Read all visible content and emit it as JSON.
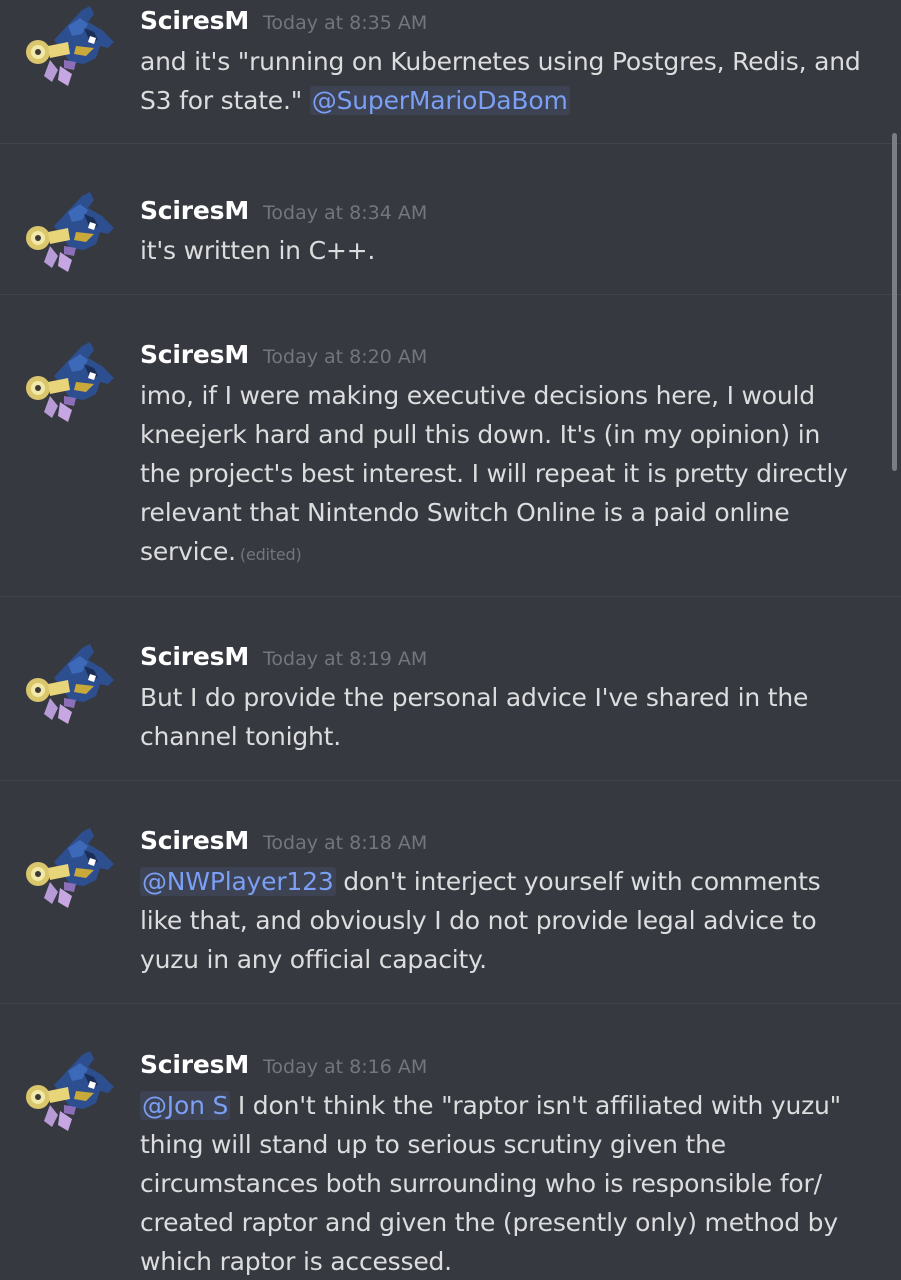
{
  "messages": [
    {
      "author": "SciresM",
      "time": "Today at 8:35 AM",
      "avatar_icon": "shark-character-avatar",
      "lines": [
        [
          {
            "t": "and it's \"running on Kubernetes using Postgres, Redis, and"
          }
        ],
        [
          {
            "t": "S3 for state.\" "
          },
          {
            "t": "@SuperMarioDaBom",
            "mention": true
          }
        ]
      ]
    },
    {
      "author": "SciresM",
      "time": "Today at 8:34 AM",
      "avatar_icon": "shark-character-avatar",
      "lines": [
        [
          {
            "t": "it's written in C++."
          }
        ]
      ]
    },
    {
      "author": "SciresM",
      "time": "Today at 8:20 AM",
      "avatar_icon": "shark-character-avatar",
      "lines": [
        [
          {
            "t": "imo, if I were making executive decisions here, I would"
          }
        ],
        [
          {
            "t": "kneejerk hard and pull this down. It's (in my opinion) in"
          }
        ],
        [
          {
            "t": "the project's best interest. I will repeat it is pretty directly"
          }
        ],
        [
          {
            "t": "relevant that Nintendo Switch Online is a paid online"
          }
        ],
        [
          {
            "t": "service."
          },
          {
            "t": "(edited)",
            "edited": true
          }
        ]
      ]
    },
    {
      "author": "SciresM",
      "time": "Today at 8:19 AM",
      "avatar_icon": "shark-character-avatar",
      "lines": [
        [
          {
            "t": "But I do provide the personal advice I've shared in the"
          }
        ],
        [
          {
            "t": "channel tonight."
          }
        ]
      ]
    },
    {
      "author": "SciresM",
      "time": "Today at 8:18 AM",
      "avatar_icon": "shark-character-avatar",
      "lines": [
        [
          {
            "t": "@NWPlayer123",
            "mention": true
          },
          {
            "t": " don't interject yourself with comments"
          }
        ],
        [
          {
            "t": "like that, and obviously I do not provide legal advice to"
          }
        ],
        [
          {
            "t": "yuzu in any official capacity."
          }
        ]
      ]
    },
    {
      "author": "SciresM",
      "time": "Today at 8:16 AM",
      "avatar_icon": "shark-character-avatar",
      "lines": [
        [
          {
            "t": "@Jon S",
            "mention": true
          },
          {
            "t": " I don't think the \"raptor isn't affiliated with yuzu\""
          }
        ],
        [
          {
            "t": "thing will stand up to serious scrutiny given the"
          }
        ],
        [
          {
            "t": "circumstances both surrounding who is responsible for/"
          }
        ],
        [
          {
            "t": "created raptor and given the (presently only) method by"
          }
        ],
        [
          {
            "t": "which raptor is accessed."
          }
        ]
      ]
    }
  ],
  "colors": {
    "background": "#36393f",
    "divider": "#42454b",
    "author": "#ffffff",
    "timestamp": "#72767d",
    "text": "#dcddde",
    "mention": "#7b9ff5"
  }
}
